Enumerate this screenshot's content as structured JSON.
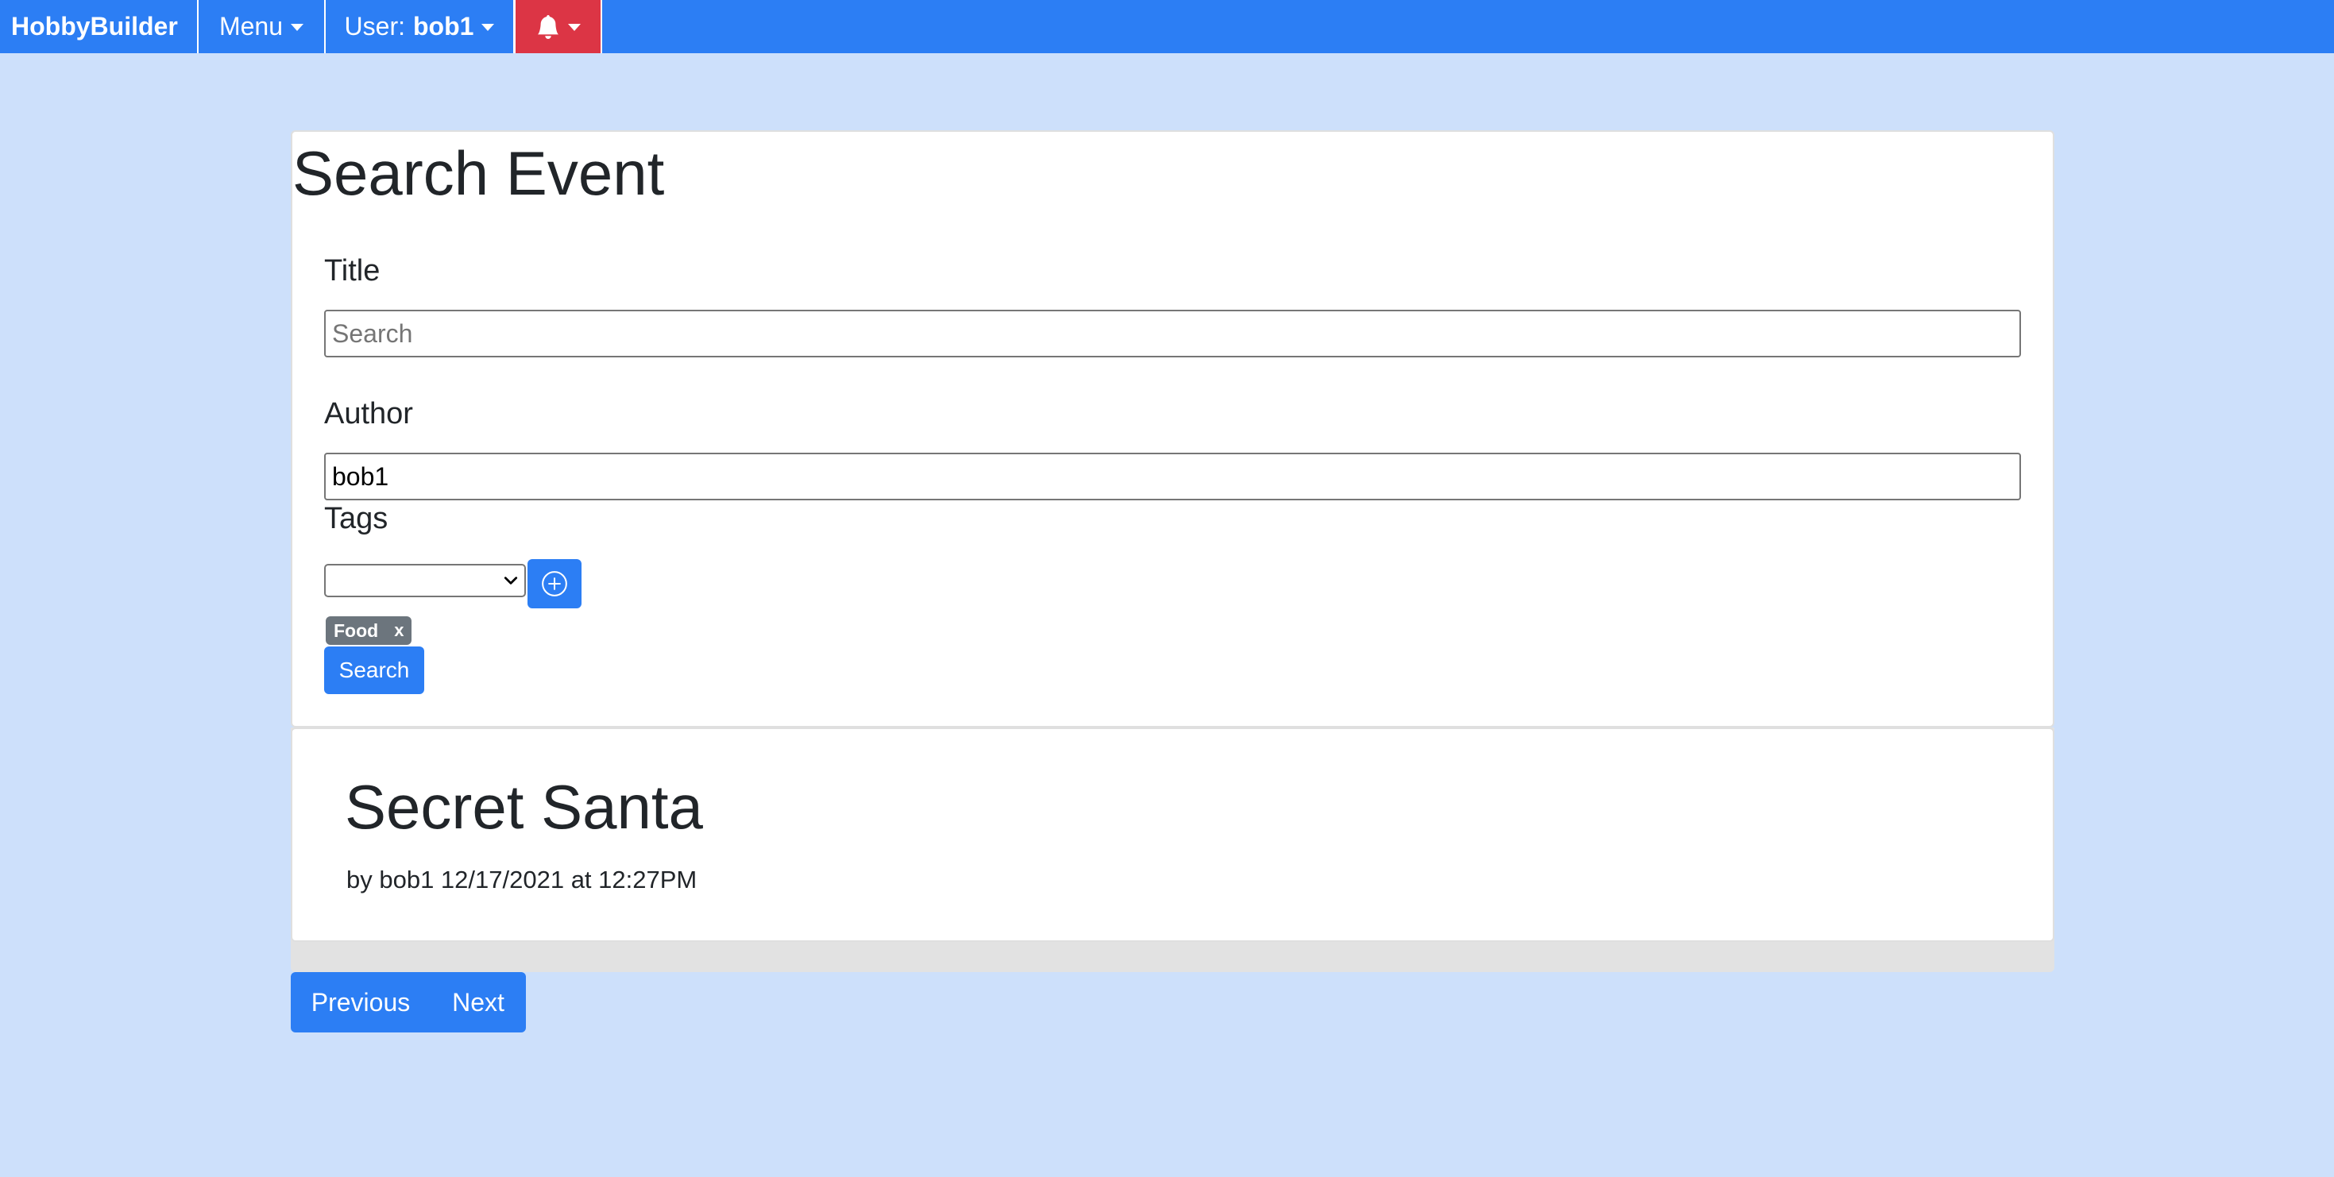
{
  "navbar": {
    "brand": "HobbyBuilder",
    "menu_label": "Menu",
    "user_prefix": "User:",
    "username": "bob1",
    "notifications_icon": "bell-icon"
  },
  "form": {
    "heading": "Search Event",
    "title_label": "Title",
    "title_placeholder": "Search",
    "title_value": "",
    "author_label": "Author",
    "author_value": "bob1",
    "tags_label": "Tags",
    "tag_select_value": "",
    "add_tag_icon": "plus-circle-icon",
    "selected_tags": [
      {
        "label": "Food",
        "remove": "x"
      }
    ],
    "search_button": "Search"
  },
  "results": [
    {
      "title": "Secret Santa",
      "meta": "by bob1 12/17/2021 at 12:27PM"
    }
  ],
  "pagination": {
    "previous": "Previous",
    "next": "Next"
  },
  "colors": {
    "primary": "#2c7ef4",
    "danger": "#dc3545",
    "badge": "#6c757d",
    "background": "#cde0fb"
  }
}
